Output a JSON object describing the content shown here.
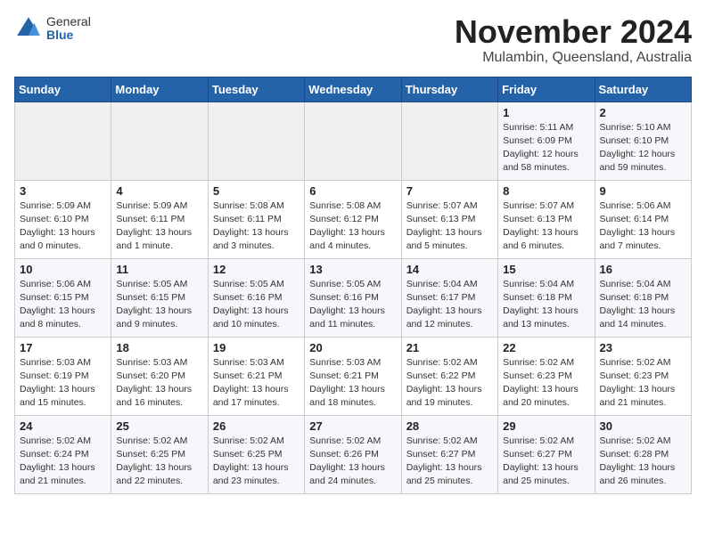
{
  "header": {
    "logo_general": "General",
    "logo_blue": "Blue",
    "month_title": "November 2024",
    "location": "Mulambin, Queensland, Australia"
  },
  "days_of_week": [
    "Sunday",
    "Monday",
    "Tuesday",
    "Wednesday",
    "Thursday",
    "Friday",
    "Saturday"
  ],
  "weeks": [
    [
      {
        "day": "",
        "empty": true
      },
      {
        "day": "",
        "empty": true
      },
      {
        "day": "",
        "empty": true
      },
      {
        "day": "",
        "empty": true
      },
      {
        "day": "",
        "empty": true
      },
      {
        "day": "1",
        "sunrise": "Sunrise: 5:11 AM",
        "sunset": "Sunset: 6:09 PM",
        "daylight": "Daylight: 12 hours and 58 minutes."
      },
      {
        "day": "2",
        "sunrise": "Sunrise: 5:10 AM",
        "sunset": "Sunset: 6:10 PM",
        "daylight": "Daylight: 12 hours and 59 minutes."
      }
    ],
    [
      {
        "day": "3",
        "sunrise": "Sunrise: 5:09 AM",
        "sunset": "Sunset: 6:10 PM",
        "daylight": "Daylight: 13 hours and 0 minutes."
      },
      {
        "day": "4",
        "sunrise": "Sunrise: 5:09 AM",
        "sunset": "Sunset: 6:11 PM",
        "daylight": "Daylight: 13 hours and 1 minute."
      },
      {
        "day": "5",
        "sunrise": "Sunrise: 5:08 AM",
        "sunset": "Sunset: 6:11 PM",
        "daylight": "Daylight: 13 hours and 3 minutes."
      },
      {
        "day": "6",
        "sunrise": "Sunrise: 5:08 AM",
        "sunset": "Sunset: 6:12 PM",
        "daylight": "Daylight: 13 hours and 4 minutes."
      },
      {
        "day": "7",
        "sunrise": "Sunrise: 5:07 AM",
        "sunset": "Sunset: 6:13 PM",
        "daylight": "Daylight: 13 hours and 5 minutes."
      },
      {
        "day": "8",
        "sunrise": "Sunrise: 5:07 AM",
        "sunset": "Sunset: 6:13 PM",
        "daylight": "Daylight: 13 hours and 6 minutes."
      },
      {
        "day": "9",
        "sunrise": "Sunrise: 5:06 AM",
        "sunset": "Sunset: 6:14 PM",
        "daylight": "Daylight: 13 hours and 7 minutes."
      }
    ],
    [
      {
        "day": "10",
        "sunrise": "Sunrise: 5:06 AM",
        "sunset": "Sunset: 6:15 PM",
        "daylight": "Daylight: 13 hours and 8 minutes."
      },
      {
        "day": "11",
        "sunrise": "Sunrise: 5:05 AM",
        "sunset": "Sunset: 6:15 PM",
        "daylight": "Daylight: 13 hours and 9 minutes."
      },
      {
        "day": "12",
        "sunrise": "Sunrise: 5:05 AM",
        "sunset": "Sunset: 6:16 PM",
        "daylight": "Daylight: 13 hours and 10 minutes."
      },
      {
        "day": "13",
        "sunrise": "Sunrise: 5:05 AM",
        "sunset": "Sunset: 6:16 PM",
        "daylight": "Daylight: 13 hours and 11 minutes."
      },
      {
        "day": "14",
        "sunrise": "Sunrise: 5:04 AM",
        "sunset": "Sunset: 6:17 PM",
        "daylight": "Daylight: 13 hours and 12 minutes."
      },
      {
        "day": "15",
        "sunrise": "Sunrise: 5:04 AM",
        "sunset": "Sunset: 6:18 PM",
        "daylight": "Daylight: 13 hours and 13 minutes."
      },
      {
        "day": "16",
        "sunrise": "Sunrise: 5:04 AM",
        "sunset": "Sunset: 6:18 PM",
        "daylight": "Daylight: 13 hours and 14 minutes."
      }
    ],
    [
      {
        "day": "17",
        "sunrise": "Sunrise: 5:03 AM",
        "sunset": "Sunset: 6:19 PM",
        "daylight": "Daylight: 13 hours and 15 minutes."
      },
      {
        "day": "18",
        "sunrise": "Sunrise: 5:03 AM",
        "sunset": "Sunset: 6:20 PM",
        "daylight": "Daylight: 13 hours and 16 minutes."
      },
      {
        "day": "19",
        "sunrise": "Sunrise: 5:03 AM",
        "sunset": "Sunset: 6:21 PM",
        "daylight": "Daylight: 13 hours and 17 minutes."
      },
      {
        "day": "20",
        "sunrise": "Sunrise: 5:03 AM",
        "sunset": "Sunset: 6:21 PM",
        "daylight": "Daylight: 13 hours and 18 minutes."
      },
      {
        "day": "21",
        "sunrise": "Sunrise: 5:02 AM",
        "sunset": "Sunset: 6:22 PM",
        "daylight": "Daylight: 13 hours and 19 minutes."
      },
      {
        "day": "22",
        "sunrise": "Sunrise: 5:02 AM",
        "sunset": "Sunset: 6:23 PM",
        "daylight": "Daylight: 13 hours and 20 minutes."
      },
      {
        "day": "23",
        "sunrise": "Sunrise: 5:02 AM",
        "sunset": "Sunset: 6:23 PM",
        "daylight": "Daylight: 13 hours and 21 minutes."
      }
    ],
    [
      {
        "day": "24",
        "sunrise": "Sunrise: 5:02 AM",
        "sunset": "Sunset: 6:24 PM",
        "daylight": "Daylight: 13 hours and 21 minutes."
      },
      {
        "day": "25",
        "sunrise": "Sunrise: 5:02 AM",
        "sunset": "Sunset: 6:25 PM",
        "daylight": "Daylight: 13 hours and 22 minutes."
      },
      {
        "day": "26",
        "sunrise": "Sunrise: 5:02 AM",
        "sunset": "Sunset: 6:25 PM",
        "daylight": "Daylight: 13 hours and 23 minutes."
      },
      {
        "day": "27",
        "sunrise": "Sunrise: 5:02 AM",
        "sunset": "Sunset: 6:26 PM",
        "daylight": "Daylight: 13 hours and 24 minutes."
      },
      {
        "day": "28",
        "sunrise": "Sunrise: 5:02 AM",
        "sunset": "Sunset: 6:27 PM",
        "daylight": "Daylight: 13 hours and 25 minutes."
      },
      {
        "day": "29",
        "sunrise": "Sunrise: 5:02 AM",
        "sunset": "Sunset: 6:27 PM",
        "daylight": "Daylight: 13 hours and 25 minutes."
      },
      {
        "day": "30",
        "sunrise": "Sunrise: 5:02 AM",
        "sunset": "Sunset: 6:28 PM",
        "daylight": "Daylight: 13 hours and 26 minutes."
      }
    ]
  ]
}
